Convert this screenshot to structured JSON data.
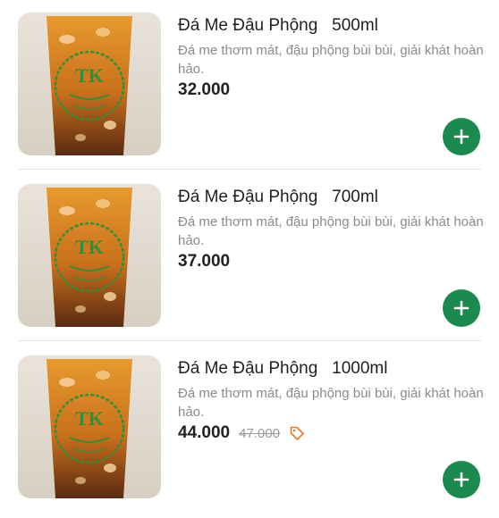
{
  "products": [
    {
      "title": "Đá Me Đậu Phộng   500ml",
      "description": "Đá me thơm mát, đậu phộng bùi bùi, giải khát hoàn hảo.",
      "price": "32.000",
      "image_logo_text": "TK"
    },
    {
      "title": "Đá Me Đậu Phộng   700ml",
      "description": "Đá me thơm mát, đậu phộng bùi bùi, giải khát hoàn hảo.",
      "price": "37.000",
      "image_logo_text": "TK"
    },
    {
      "title": "Đá Me Đậu Phộng   1000ml",
      "description": "Đá me thơm mát, đậu phộng bùi bùi, giải khát hoàn hảo.",
      "price": "44.000",
      "old_price": "47.000",
      "image_logo_text": "TK"
    }
  ],
  "icons": {
    "add": "plus-icon",
    "discount": "tag-icon"
  },
  "colors": {
    "add_button": "#1a8a4e",
    "discount_tag": "#e8782a",
    "price": "#222222",
    "description": "#8a8a8a"
  }
}
